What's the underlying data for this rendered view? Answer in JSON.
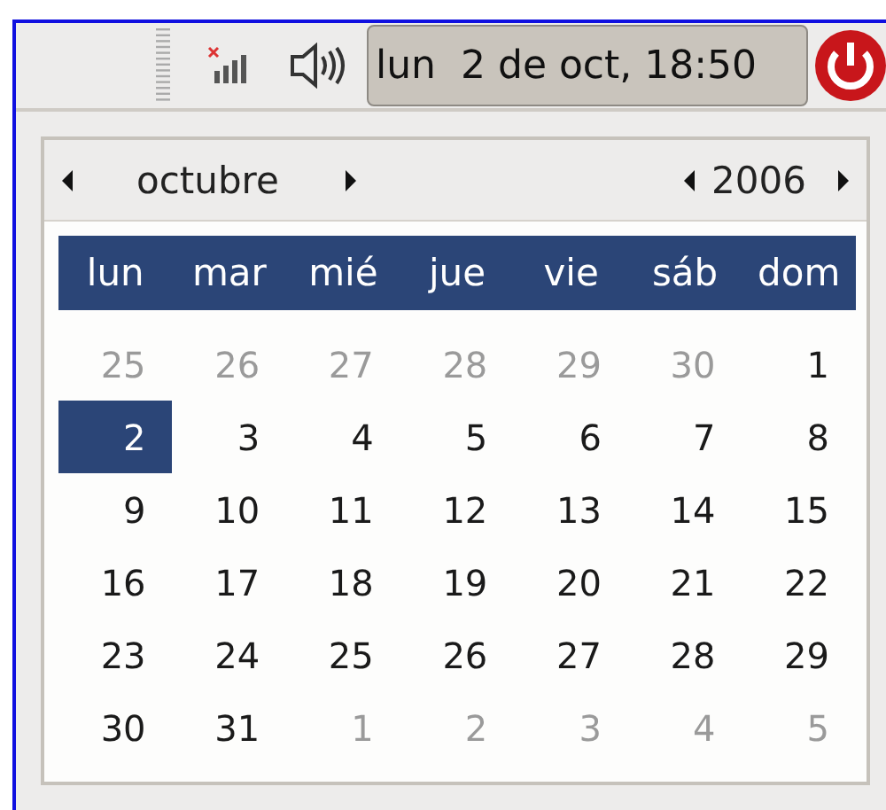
{
  "panel": {
    "clock": "lun  2 de oct, 18:50"
  },
  "calendar": {
    "month": "octubre",
    "year": "2006",
    "weekdays": [
      "lun",
      "mar",
      "mié",
      "jue",
      "vie",
      "sáb",
      "dom"
    ],
    "weeks": [
      [
        {
          "day": "25",
          "outside": true,
          "selected": false
        },
        {
          "day": "26",
          "outside": true,
          "selected": false
        },
        {
          "day": "27",
          "outside": true,
          "selected": false
        },
        {
          "day": "28",
          "outside": true,
          "selected": false
        },
        {
          "day": "29",
          "outside": true,
          "selected": false
        },
        {
          "day": "30",
          "outside": true,
          "selected": false
        },
        {
          "day": "1",
          "outside": false,
          "selected": false
        }
      ],
      [
        {
          "day": "2",
          "outside": false,
          "selected": true
        },
        {
          "day": "3",
          "outside": false,
          "selected": false
        },
        {
          "day": "4",
          "outside": false,
          "selected": false
        },
        {
          "day": "5",
          "outside": false,
          "selected": false
        },
        {
          "day": "6",
          "outside": false,
          "selected": false
        },
        {
          "day": "7",
          "outside": false,
          "selected": false
        },
        {
          "day": "8",
          "outside": false,
          "selected": false
        }
      ],
      [
        {
          "day": "9",
          "outside": false,
          "selected": false
        },
        {
          "day": "10",
          "outside": false,
          "selected": false
        },
        {
          "day": "11",
          "outside": false,
          "selected": false
        },
        {
          "day": "12",
          "outside": false,
          "selected": false
        },
        {
          "day": "13",
          "outside": false,
          "selected": false
        },
        {
          "day": "14",
          "outside": false,
          "selected": false
        },
        {
          "day": "15",
          "outside": false,
          "selected": false
        }
      ],
      [
        {
          "day": "16",
          "outside": false,
          "selected": false
        },
        {
          "day": "17",
          "outside": false,
          "selected": false
        },
        {
          "day": "18",
          "outside": false,
          "selected": false
        },
        {
          "day": "19",
          "outside": false,
          "selected": false
        },
        {
          "day": "20",
          "outside": false,
          "selected": false
        },
        {
          "day": "21",
          "outside": false,
          "selected": false
        },
        {
          "day": "22",
          "outside": false,
          "selected": false
        }
      ],
      [
        {
          "day": "23",
          "outside": false,
          "selected": false
        },
        {
          "day": "24",
          "outside": false,
          "selected": false
        },
        {
          "day": "25",
          "outside": false,
          "selected": false
        },
        {
          "day": "26",
          "outside": false,
          "selected": false
        },
        {
          "day": "27",
          "outside": false,
          "selected": false
        },
        {
          "day": "28",
          "outside": false,
          "selected": false
        },
        {
          "day": "29",
          "outside": false,
          "selected": false
        }
      ],
      [
        {
          "day": "30",
          "outside": false,
          "selected": false
        },
        {
          "day": "31",
          "outside": false,
          "selected": false
        },
        {
          "day": "1",
          "outside": true,
          "selected": false
        },
        {
          "day": "2",
          "outside": true,
          "selected": false
        },
        {
          "day": "3",
          "outside": true,
          "selected": false
        },
        {
          "day": "4",
          "outside": true,
          "selected": false
        },
        {
          "day": "5",
          "outside": true,
          "selected": false
        }
      ]
    ]
  }
}
